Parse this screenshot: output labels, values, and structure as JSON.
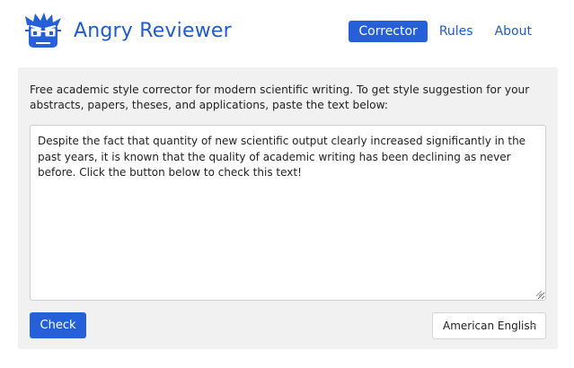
{
  "header": {
    "logo_icon": "angry-reviewer-face-icon",
    "brand_name": "Angry Reviewer",
    "nav": [
      {
        "label": "Corrector",
        "active": true
      },
      {
        "label": "Rules",
        "active": false
      },
      {
        "label": "About",
        "active": false
      }
    ]
  },
  "main": {
    "description": "Free academic style corrector for modern scientific writing. To get style suggestion for your abstracts, papers, theses, and applications, paste the text below:",
    "editor_text": "Despite the fact that quantity of new scientific output clearly increased significantly in the past years, it is known that the quality of academic writing has been declining as never before. Click the button below to check this text!",
    "check_label": "Check",
    "language_selected": "American English",
    "language_chevron_icon": "chevron-down-icon"
  },
  "colors": {
    "brand_blue": "#2560d8",
    "panel_bg": "#f1f1f1"
  }
}
